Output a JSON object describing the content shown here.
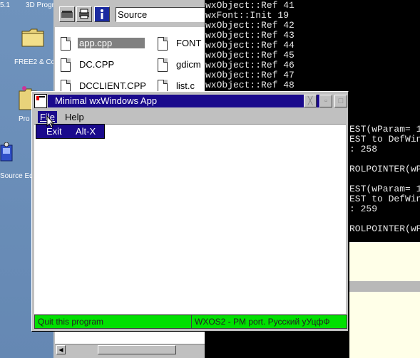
{
  "desktop": {
    "icons": [
      {
        "label": "5.1",
        "icon": "folder-icon"
      },
      {
        "label": "3D Progr",
        "icon": "folder-icon"
      },
      {
        "label": "FREE2 & Co",
        "icon": "folder-icon"
      },
      {
        "label": "Pro",
        "icon": "folder-icon"
      },
      {
        "label": "Source Edi",
        "icon": "editor-icon"
      }
    ]
  },
  "file_manager": {
    "path_value": "Source",
    "toolbar_icons": [
      "drive-icon",
      "printer-icon",
      "info-icon"
    ],
    "files": [
      {
        "name": "app.cpp",
        "selected": true
      },
      {
        "name": "FONT",
        "selected": false
      },
      {
        "name": "DC.CPP",
        "selected": false
      },
      {
        "name": "gdicm",
        "selected": false
      },
      {
        "name": "DCCLIENT.CPP",
        "selected": false
      },
      {
        "name": "list.c",
        "selected": false
      }
    ]
  },
  "console": {
    "lines": [
      "wxObject::Ref 41",
      "wxFont::Init 19",
      "wxObject::Ref 42",
      "wxObject::Ref 43",
      "wxObject::Ref 44",
      "wxObject::Ref 45",
      "wxObject::Ref 46",
      "wxObject::Ref 47",
      "wxObject::Ref 48"
    ],
    "right_lines": [
      "EST(wParam= 1",
      "EST to DefWin",
      ": 258",
      "",
      "ROLPOINTER(wP",
      "",
      "EST(wParam= 1",
      "EST to DefWin",
      ": 259",
      "",
      "ROLPOINTER(wP"
    ]
  },
  "app_window": {
    "title": "Minimal wxWindows App",
    "menus": [
      {
        "label": "File",
        "open": true
      },
      {
        "label": "Help",
        "open": false
      }
    ],
    "file_menu_items": [
      {
        "label": "Exit",
        "shortcut": "Alt-X"
      }
    ],
    "status": {
      "left": "Quit this program",
      "right": "WXOS2 - PM port. Русский уУцфФ"
    },
    "colors": {
      "titlebar": "#1a0a8c",
      "statusbar": "#00e000"
    }
  }
}
